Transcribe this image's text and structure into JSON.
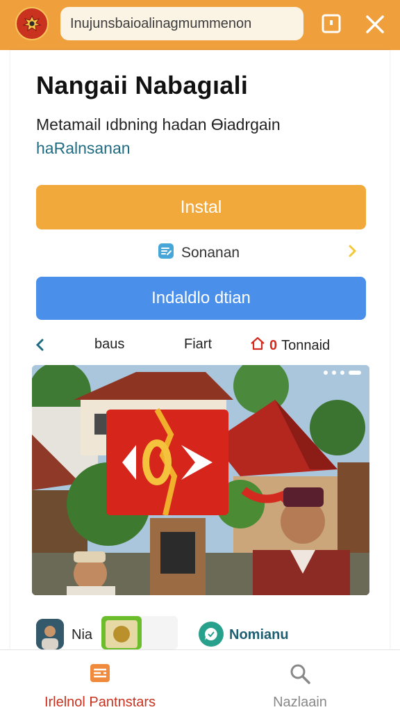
{
  "header": {
    "url_text": "Inujunsbaioalinagmummenon",
    "logo_icon": "garuda-emblem-icon",
    "tab_icon": "tab-switcher-icon",
    "close_icon": "close-icon",
    "accent_color": "#ef9f3b"
  },
  "main": {
    "title": "Nangaii Nabagıali",
    "subtitle": "Metamail ıdbning hadan Өiadrgain",
    "sub_link": "haRalnsanan",
    "install_label": "Instal",
    "secondary_label": "Sonanan",
    "blue_button_label": "Indaldlo dtian",
    "tabs": [
      {
        "label": "baus"
      },
      {
        "label": "Fiart"
      },
      {
        "label": "Tonnaid",
        "count": "0"
      }
    ]
  },
  "cards": {
    "item1_label": "Nia",
    "item2_label": "Nomianu"
  },
  "bottom_nav": {
    "left_label": "Irlelnol Pantnstars",
    "right_label": "Nazlaain"
  }
}
